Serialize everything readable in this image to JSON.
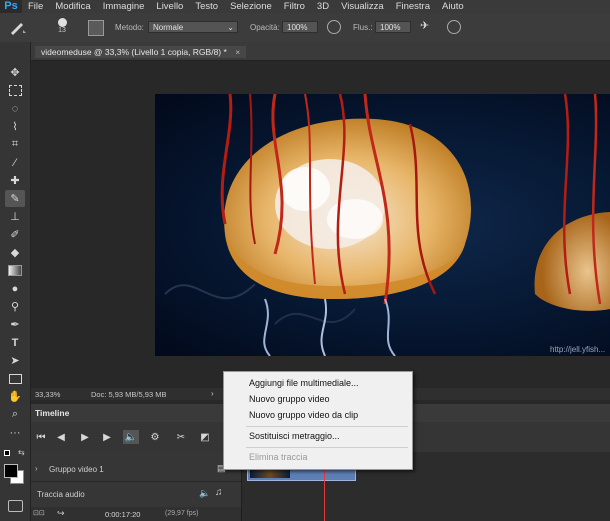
{
  "app": {
    "logo": "Ps"
  },
  "menu": [
    "File",
    "Modifica",
    "Immagine",
    "Livello",
    "Testo",
    "Selezione",
    "Filtro",
    "3D",
    "Visualizza",
    "Finestra",
    "Aiuto"
  ],
  "options": {
    "brush_size": "13",
    "metodo_label": "Metodo:",
    "metodo_value": "Normale",
    "opacita_label": "Opacità:",
    "opacita_value": "100%",
    "flusso_label": "Flus.:",
    "flusso_value": "100%"
  },
  "document": {
    "tab_title": "videomeduse @ 33,3% (Livello 1 copia, RGB/8) *",
    "close_glyph": "×",
    "watermark": "http://jell.yfish..."
  },
  "status": {
    "zoom": "33,33%",
    "doc_info": "Doc: 5,93 MB/5,93 MB"
  },
  "timeline": {
    "tab_title": "Timeline",
    "tracks": [
      {
        "label": "Gruppo video 1"
      },
      {
        "label": "Traccia audio"
      }
    ],
    "timecode": "0:00:17:20",
    "fps": "(29,97 fps)"
  },
  "context_menu": {
    "items": [
      {
        "label": "Aggiungi file multimediale...",
        "enabled": true
      },
      {
        "label": "Nuovo gruppo video",
        "enabled": true
      },
      {
        "label": "Nuovo gruppo video da clip",
        "enabled": true
      },
      {
        "label": "Sostituisci metraggio...",
        "enabled": true
      },
      {
        "label": "Elimina traccia",
        "enabled": false
      }
    ]
  },
  "colors": {
    "accent": "#31a8ff",
    "clip": "#5d7fb4",
    "playhead": "#e23b3b"
  }
}
